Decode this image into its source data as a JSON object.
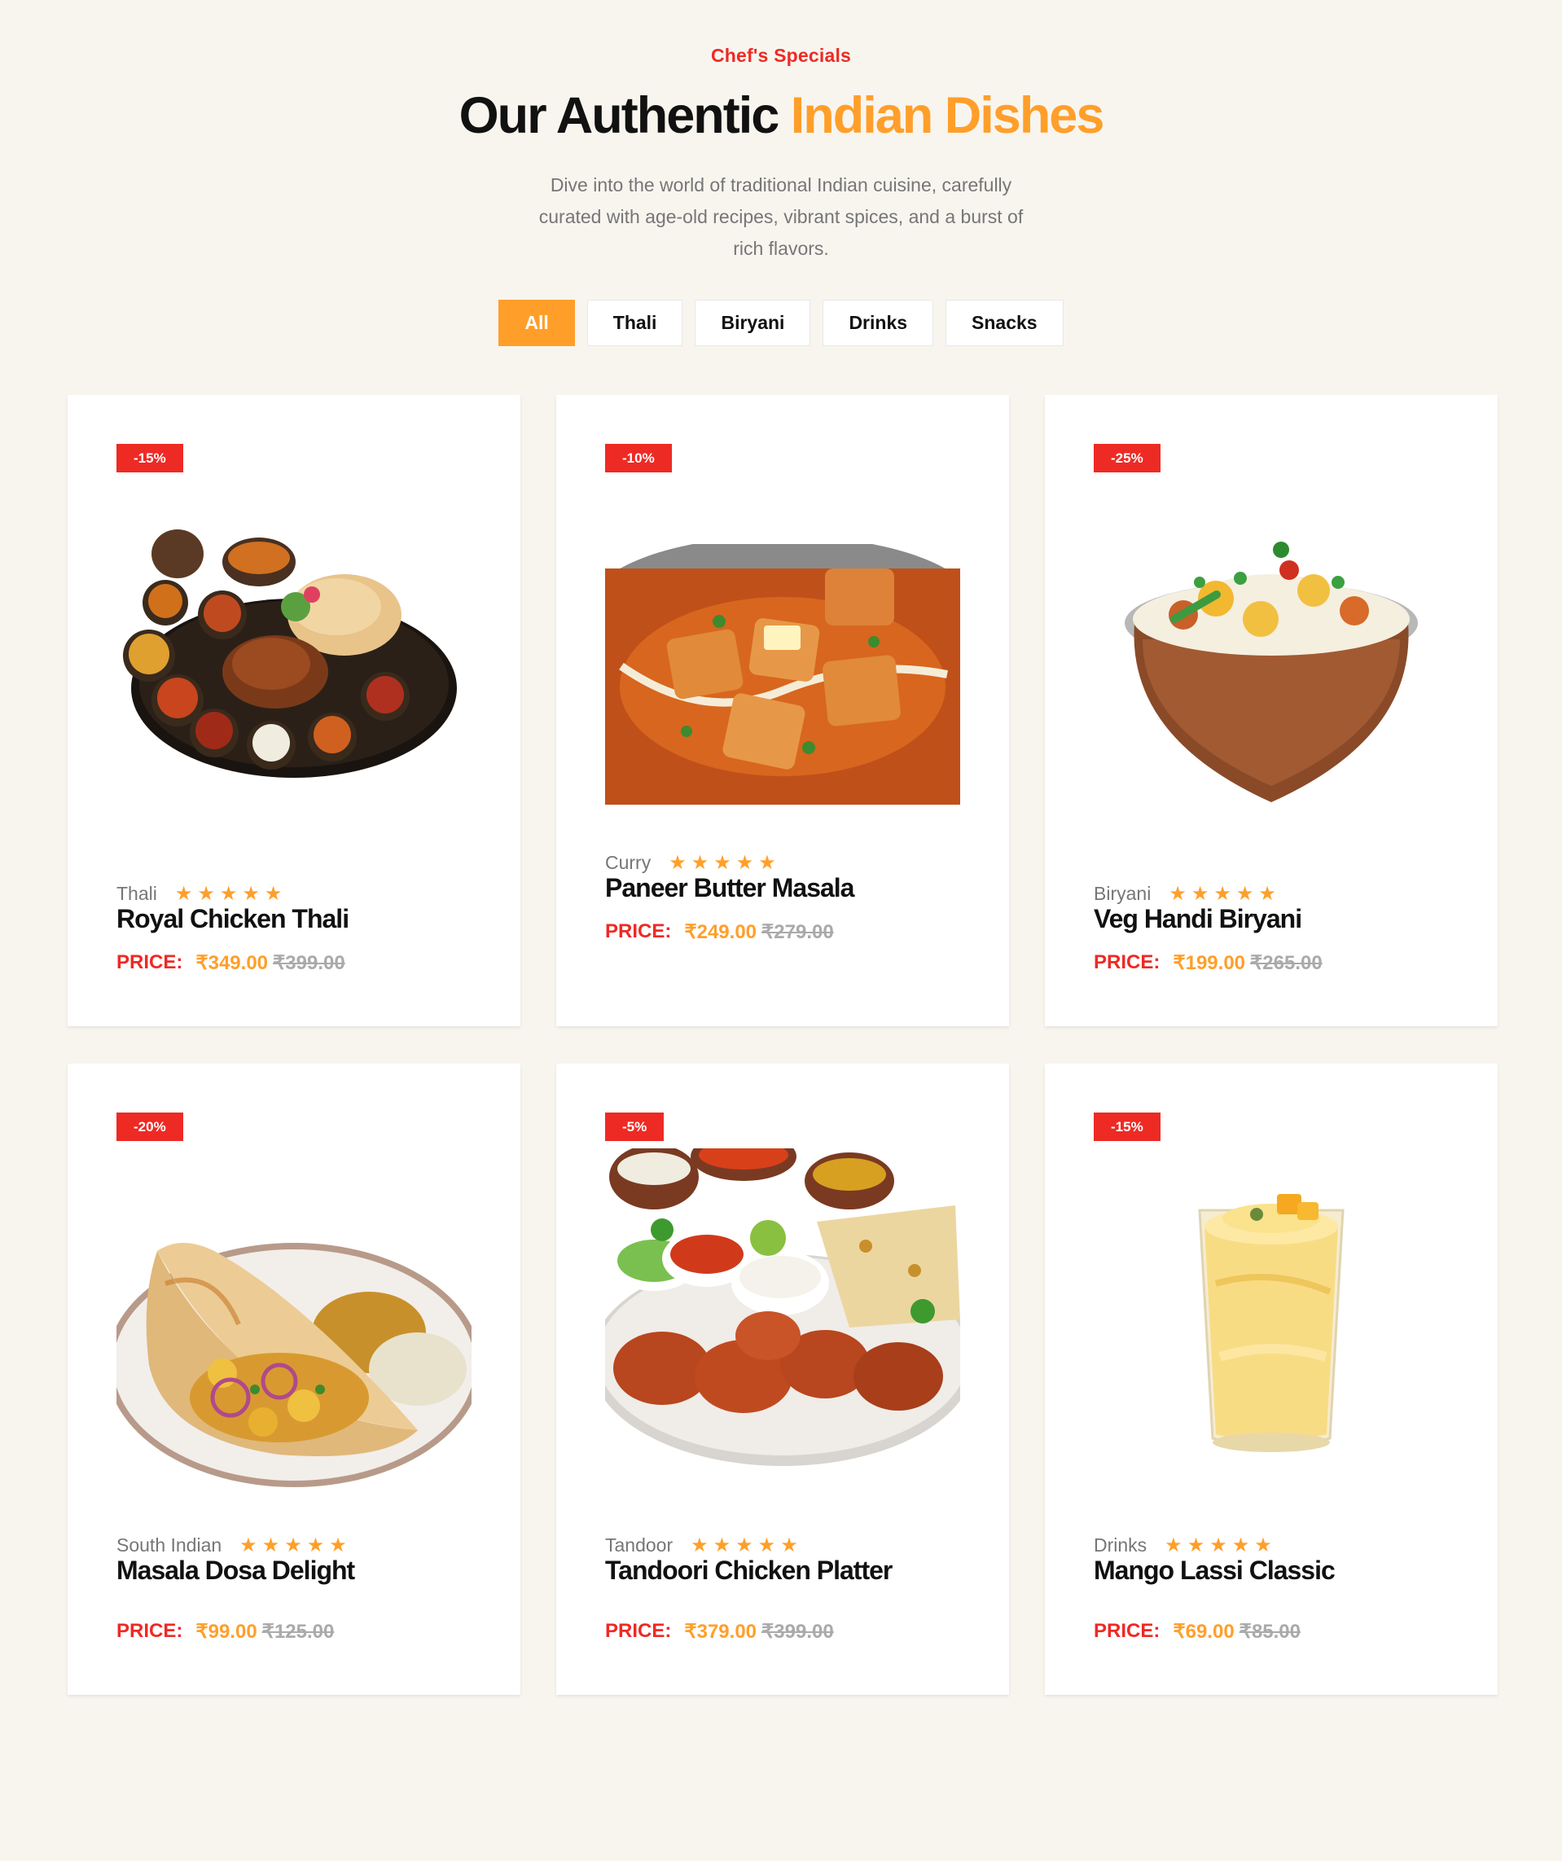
{
  "section": {
    "eyebrow": "Chef's Specials",
    "title_main": "Our Authentic ",
    "title_accent": "Indian Dishes",
    "description": "Dive into the world of traditional Indian cuisine, carefully curated with age-old recipes, vibrant spices, and a burst of rich flavors."
  },
  "filters": [
    {
      "label": "All",
      "active": true
    },
    {
      "label": "Thali",
      "active": false
    },
    {
      "label": "Biryani",
      "active": false
    },
    {
      "label": "Drinks",
      "active": false
    },
    {
      "label": "Snacks",
      "active": false
    }
  ],
  "price_label": "PRICE:",
  "stars": "★★★★★",
  "colors": {
    "accent": "#ff9f2a",
    "red": "#ee2a24",
    "background": "#f8f5ef"
  },
  "dishes": [
    {
      "badge": "-15%",
      "category": "Thali",
      "name": "Royal Chicken Thali",
      "price": "₹349.00",
      "old_price": "₹399.00",
      "rating": 5,
      "image": "thali-plate"
    },
    {
      "badge": "-10%",
      "category": "Curry",
      "name": "Paneer Butter Masala",
      "price": "₹249.00",
      "old_price": "₹279.00",
      "rating": 5,
      "image": "paneer-curry"
    },
    {
      "badge": "-25%",
      "category": "Biryani",
      "name": "Veg Handi Biryani",
      "price": "₹199.00",
      "old_price": "₹265.00",
      "rating": 5,
      "image": "biryani-handi"
    },
    {
      "badge": "-20%",
      "category": "South Indian",
      "name": "Masala Dosa Delight",
      "price": "₹99.00",
      "old_price": "₹125.00",
      "rating": 5,
      "image": "masala-dosa"
    },
    {
      "badge": "-5%",
      "category": "Tandoor",
      "name": "Tandoori Chicken Platter",
      "price": "₹379.00",
      "old_price": "₹399.00",
      "rating": 5,
      "image": "tandoori-platter"
    },
    {
      "badge": "-15%",
      "category": "Drinks",
      "name": "Mango Lassi Classic",
      "price": "₹69.00",
      "old_price": "₹85.00",
      "rating": 5,
      "image": "mango-lassi"
    }
  ]
}
